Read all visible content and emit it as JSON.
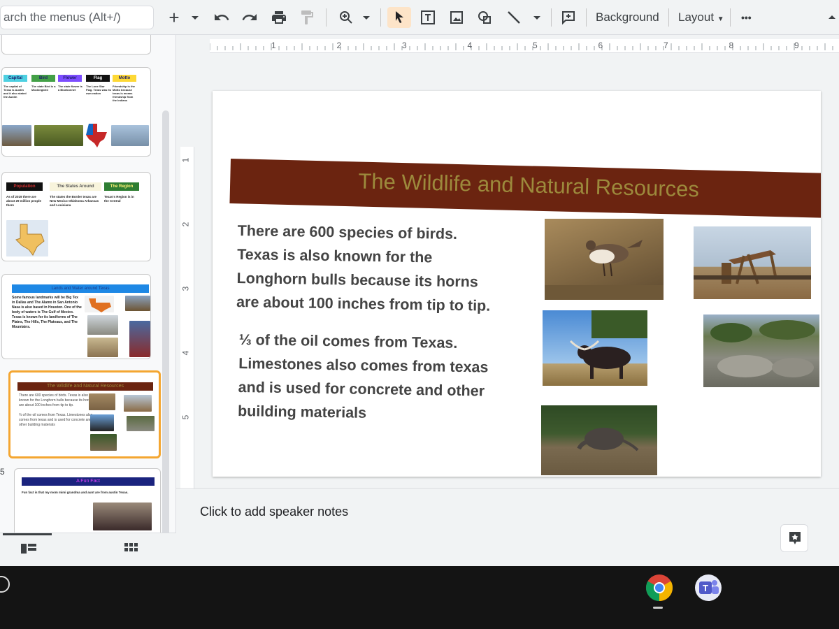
{
  "toolbar": {
    "search_placeholder": "arch the menus (Alt+/)",
    "add_icon": "+",
    "background_label": "Background",
    "layout_label": "Layout",
    "more_label": "•••",
    "collapse_icon": "chevron-up-icon"
  },
  "ruler": {
    "horizontal": [
      "1",
      "2",
      "3",
      "4",
      "5",
      "6",
      "7",
      "8",
      "9"
    ],
    "vertical": [
      "1",
      "2",
      "3",
      "4",
      "5"
    ]
  },
  "filmstrip": {
    "slide_number_partial": "5",
    "slide_a": {
      "headers": [
        "Capital",
        "Bird",
        "Flower",
        "Flag",
        "Motto"
      ],
      "header_colors": [
        "#4dd0e1",
        "#43a047",
        "#7c4dff",
        "#111111",
        "#fdd835"
      ],
      "col_texts": [
        "The capital of Texas is Austin and it also stated the Austin",
        "The state Bird is a Mockingbird",
        "The state flower is a Bluebonnet",
        "The Lone Star Flag. Texas was its own nation",
        "Friendship is the Motto because texas is means friendship from the Indians"
      ]
    },
    "slide_b": {
      "headers": [
        "Population",
        "The States Around",
        "The Region"
      ],
      "col_texts": [
        "As of 2019 there are about 29 million people there",
        "The states the Border texas are New Mexico Oklahoma Arkansas and Louisiana",
        "Texas's Region is in the Central"
      ]
    },
    "slide_c": {
      "title": "Lands and Water around Texas",
      "text": "Some famous landmarks will be Big Tex in Dallas and The Alamo in San Antonio Nasa is also based in Houston. One of the body of waters is The Gulf of Mexico. Texas is known for its landforms of The Plains, The Hills, The Plateaus, and The Mountains."
    },
    "slide_d": {
      "title": "The Wildlife and Natural Resources",
      "text1": "There are 600 species of birds. Texas is also known for the Longhorn bulls because its horns are about 100 inches from tip to tip.",
      "text2": "⅓ of the oil comes from Texas. Limestones also comes from texas and is used for concrete and other building materials"
    },
    "slide_e": {
      "title": "A Fun Fact",
      "text": "Fun fact is that my mom mimi grandma and aunt are from austin Texas."
    }
  },
  "slide": {
    "title": "The Wildlife and Natural Resources",
    "title_color": "#9c8a3c",
    "band_color": "#6b2410",
    "paragraph1_lines": [
      "There are 600 species of birds.",
      "Texas is also known for the",
      "Longhorn bulls because its horns",
      "are about 100 inches from tip to tip."
    ],
    "paragraph2_lines": [
      "⅓ of the oil comes from Texas.",
      "Limestones also comes from texas",
      "and is used for concrete and other",
      "building materials"
    ]
  },
  "notes": {
    "placeholder": "Click to add speaker notes"
  },
  "taskbar": {
    "apps": [
      "chrome-icon",
      "teams-icon"
    ]
  }
}
